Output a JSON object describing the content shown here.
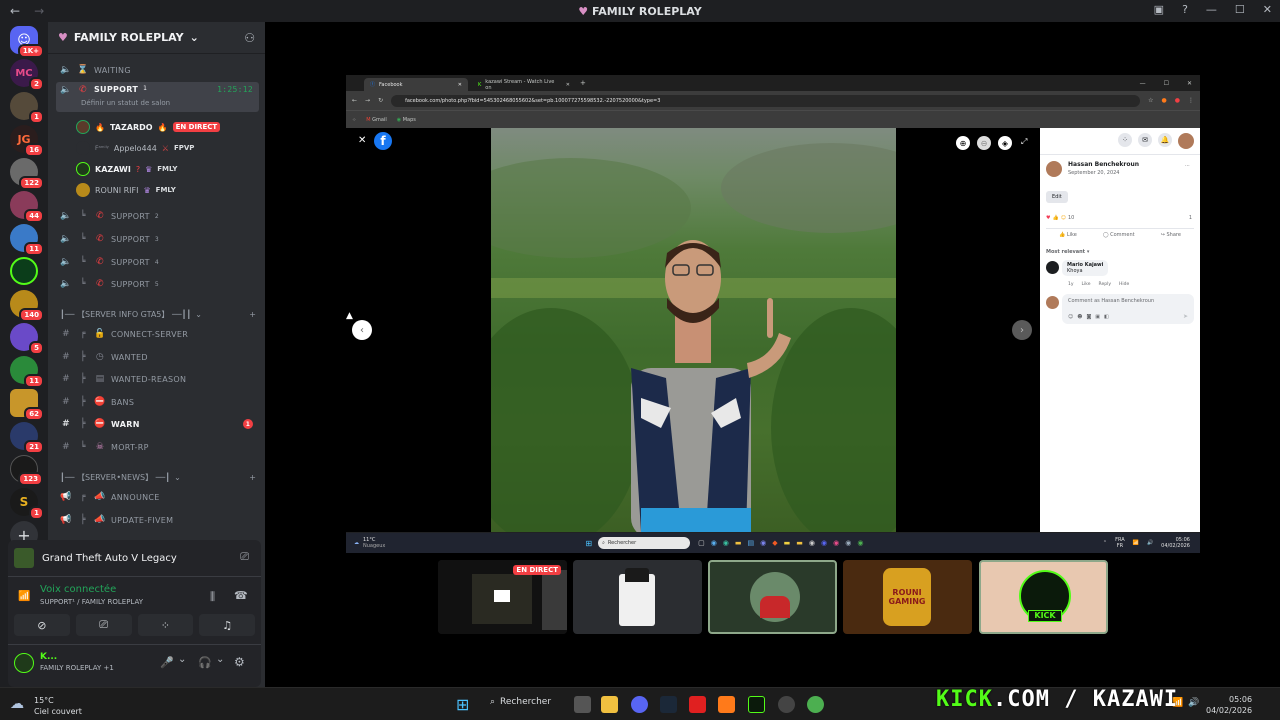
{
  "window": {
    "title": "FAMILY ROLEPLAY"
  },
  "server": {
    "name": "FAMILY ROLEPLAY"
  },
  "guild_badges": [
    "1K+",
    "2",
    "1",
    "16",
    "122",
    "44",
    "11",
    "140",
    "5",
    "11",
    "62",
    "21",
    "123",
    "1"
  ],
  "channels": {
    "waiting": "WAITING",
    "support1": {
      "name": "SUPPORT",
      "sup": "1",
      "time": "1:25:12",
      "status": "Définir un statut de salon"
    },
    "members": [
      {
        "name": "TAZARDO",
        "tag": "EN DIRECT"
      },
      {
        "name": "Appelo444",
        "prefix": "Fᵃᵐⁱˡʸ",
        "tag": "FPVP"
      },
      {
        "name": "KAZAWI",
        "tag": "FMLY"
      },
      {
        "name": "ROUNI RIFI",
        "tag": "FMLY"
      }
    ],
    "support2": {
      "name": "SUPPORT",
      "sup": "2"
    },
    "support3": {
      "name": "SUPPORT",
      "sup": "3"
    },
    "support4": {
      "name": "SUPPORT",
      "sup": "4"
    },
    "support5": {
      "name": "SUPPORT",
      "sup": "5"
    },
    "cat_info": "┃── 【SERVER INFO GTA5】 ──┃┃",
    "connect": "CONNECT-SERVER",
    "wanted": "WANTED",
    "wanted_reason": "WANTED-REASON",
    "bans": "BANS",
    "warn": "WARN",
    "warn_badge": "1",
    "mort": "MORT-RP",
    "cat_news": "┃── 【SERVER•NEWS】 ──┃",
    "announce": "ANNOUNCE",
    "update": "UPDATE-FIVEM"
  },
  "activity": {
    "game": "Grand Theft Auto V Legacy"
  },
  "voice": {
    "status": "Voix connectée",
    "channel": "SUPPORT¹ / FAMILY ROLEPLAY"
  },
  "user": {
    "name": "K...",
    "sub": "FAMILY ROLEPLAY +1"
  },
  "browser": {
    "tabs": [
      "Facebook",
      "kazawi Stream - Watch Live on"
    ],
    "url": "facebook.com/photo.php?fbid=545302468055602&set=pb.100077275598532.-2207520000&type=3",
    "bookmarks": [
      "Gmail",
      "Maps"
    ]
  },
  "fb": {
    "author": "Hassan Benchekroun",
    "date": "September 20, 2024",
    "edit": "Edit",
    "reactions": "10",
    "comments_count": "1",
    "like": "Like",
    "comment": "Comment",
    "share": "Share",
    "sort": "Most relevant",
    "commenter": "Mario Kajawi",
    "comment_text": "Khoya",
    "comment_time": "1y",
    "c_like": "Like",
    "c_reply": "Reply",
    "c_hide": "Hide",
    "input_placeholder": "Comment as Hassan Benchekroun"
  },
  "inner_taskbar": {
    "weather": "11°C",
    "weather_sub": "Nuageux",
    "search": "Rechercher",
    "lang": "FRA",
    "lang2": "FR",
    "time": "05:06",
    "date": "04/02/2026"
  },
  "thumbs": {
    "live_badge": "EN DIRECT",
    "kick": "KICK",
    "rouni": "ROUNI GAMING"
  },
  "taskbar": {
    "temp": "15°C",
    "weather": "Ciel couvert",
    "search": "Rechercher",
    "time": "05:06",
    "date": "04/02/2026"
  },
  "overlay": {
    "text1": "KICK",
    "text2": ".COM / KAZAWI"
  }
}
